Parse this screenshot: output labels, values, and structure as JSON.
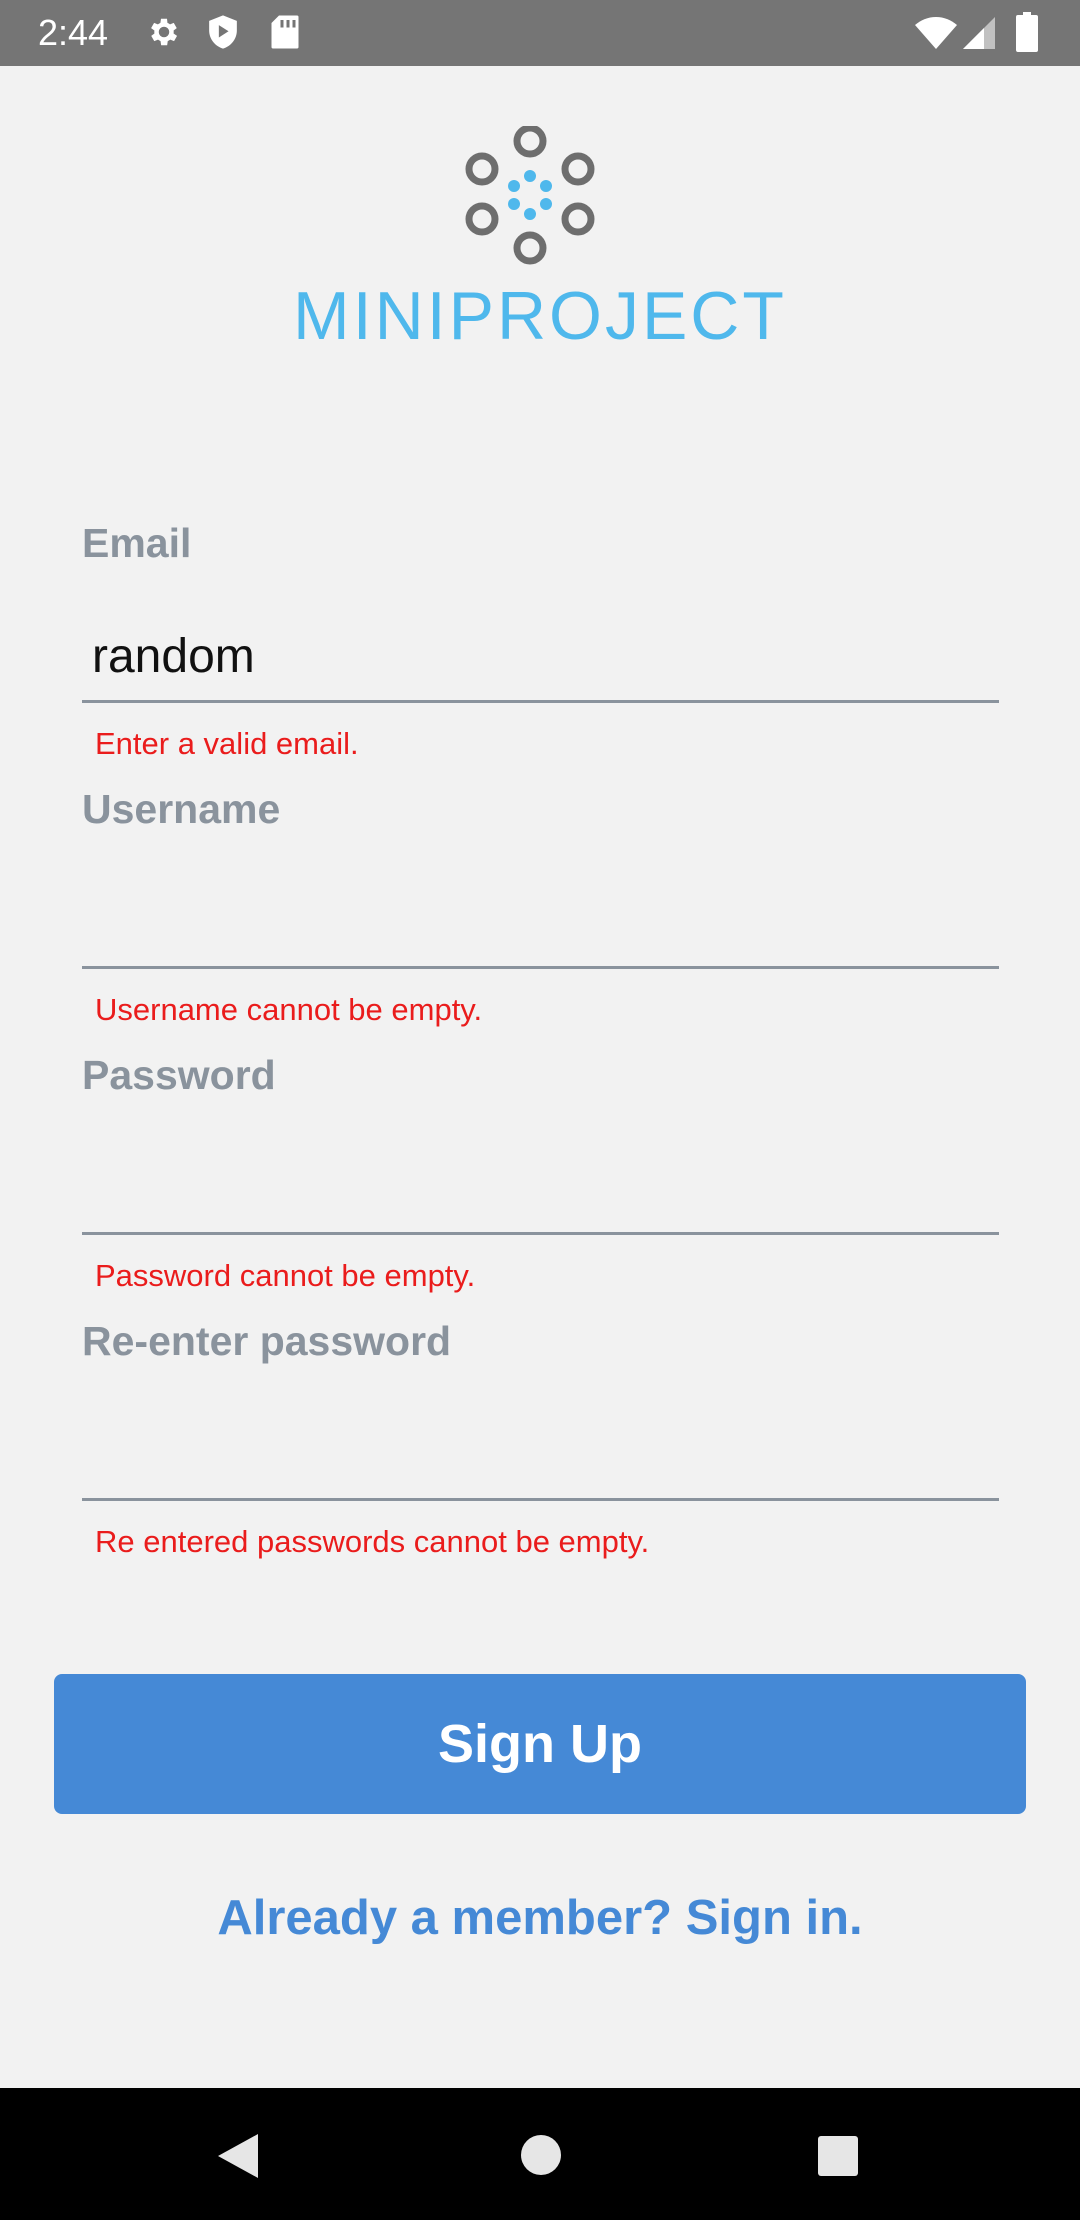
{
  "status_bar": {
    "time": "2:44",
    "left_icons": [
      "gear-icon",
      "shield-icon",
      "sd-card-icon"
    ],
    "right_icons": [
      "wifi-icon",
      "cell-signal-icon",
      "battery-icon"
    ]
  },
  "logo": {
    "text": "MINIPROJECT",
    "colors": {
      "ring": "#6e6e6e",
      "dots": "#4fb8ec"
    }
  },
  "form": {
    "email": {
      "label": "Email",
      "value": "random",
      "error": "Enter a valid email."
    },
    "username": {
      "label": "Username",
      "value": "",
      "error": "Username cannot be empty."
    },
    "password": {
      "label": "Password",
      "value": "",
      "error": "Password cannot be empty."
    },
    "reenter_password": {
      "label": "Re-enter password",
      "value": "",
      "error": "Re entered passwords cannot be empty."
    }
  },
  "actions": {
    "signup_label": "Sign Up",
    "signin_link": "Already a member? Sign in."
  },
  "colors": {
    "accent": "#4589d6",
    "error": "#ea1c1c",
    "label": "#8a939d",
    "background": "#f2f2f2"
  },
  "nav_bar": {
    "icons": [
      "back-icon",
      "home-icon",
      "recents-icon"
    ]
  }
}
